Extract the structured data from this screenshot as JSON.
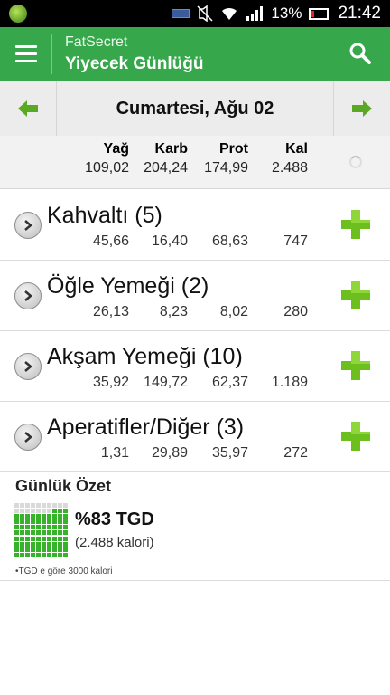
{
  "status_bar": {
    "battery_pct": "13%",
    "time": "21:42",
    "icons": [
      "app-icon",
      "battery-small-icon",
      "mute-icon",
      "wifi-icon",
      "signal-icon",
      "battery-icon"
    ]
  },
  "app_bar": {
    "app_name": "FatSecret",
    "title": "Yiyecek Günlüğü",
    "accent": "#36a74a"
  },
  "date_nav": {
    "date": "Cumartesi, Ağu 02"
  },
  "totals": {
    "headers": {
      "fat": "Yağ",
      "carb": "Karb",
      "prot": "Prot",
      "kcal": "Kal"
    },
    "values": {
      "fat": "109,02",
      "carb": "204,24",
      "prot": "174,99",
      "kcal": "2.488"
    }
  },
  "meals": [
    {
      "title": "Kahvaltı (5)",
      "fat": "45,66",
      "carb": "16,40",
      "prot": "68,63",
      "kcal": "747"
    },
    {
      "title": "Öğle Yemeği (2)",
      "fat": "26,13",
      "carb": "8,23",
      "prot": "8,02",
      "kcal": "280"
    },
    {
      "title": "Akşam Yemeği (10)",
      "fat": "35,92",
      "carb": "149,72",
      "prot": "62,37",
      "kcal": "1.189"
    },
    {
      "title": "Aperatifler/Diğer (3)",
      "fat": "1,31",
      "carb": "29,89",
      "prot": "35,97",
      "kcal": "272"
    }
  ],
  "summary": {
    "title": "Günlük Özet",
    "percent_label": "%83 TGD",
    "percent_value": 83,
    "calories": "(2.488 kalori)",
    "note": "•TGD e göre 3000 kalori"
  }
}
